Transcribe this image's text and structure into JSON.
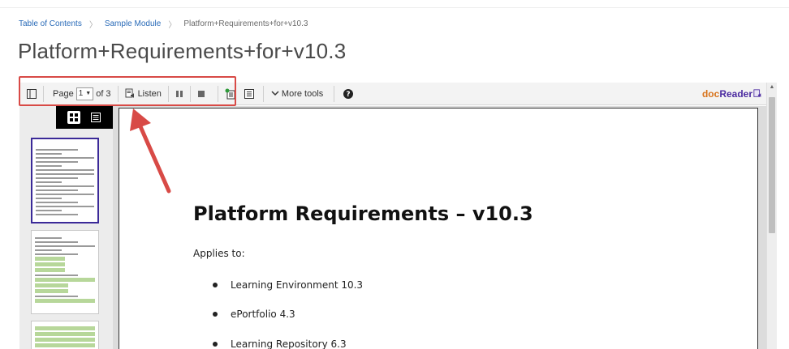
{
  "breadcrumb": {
    "items": [
      "Table of Contents",
      "Sample Module",
      "Platform+Requirements+for+v10.3"
    ],
    "separator": "〉"
  },
  "page_title": "Platform+Requirements+for+v10.3",
  "toolbar": {
    "page_label": "Page",
    "page_value": "1",
    "page_of": "of 3",
    "listen_label": "Listen",
    "more_tools_label": "More tools",
    "brand_doc": "doc",
    "brand_reader": "Reader"
  },
  "sidebar": {
    "view_modes": [
      "thumbnail-grid",
      "list"
    ],
    "active_view": "thumbnail-grid",
    "selected_thumbnail": 1
  },
  "document": {
    "heading": "Platform Requirements – v10.3",
    "applies_to": "Applies to:",
    "bullets": [
      "Learning Environment 10.3",
      "ePortfolio 4.3",
      "Learning Repository 6.3"
    ]
  },
  "colors": {
    "annotation_red": "#d84a46",
    "brand_orange": "#d8731b",
    "brand_purple": "#4b2aa0",
    "link_blue": "#2a6bb8"
  }
}
